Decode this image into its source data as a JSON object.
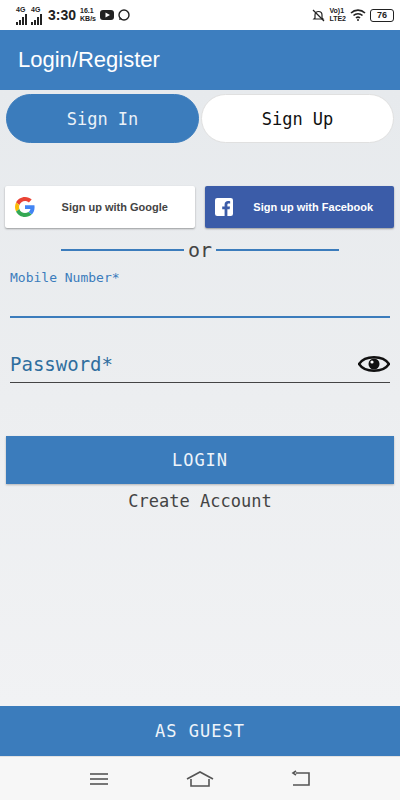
{
  "status_bar": {
    "networks": [
      "4G",
      "4G"
    ],
    "time": "3:30",
    "speed": [
      "16.1",
      "KB/s"
    ],
    "carrier": [
      "Vo)1",
      "LTE2"
    ],
    "battery": "76"
  },
  "app_bar": {
    "title": "Login/Register"
  },
  "tabs": [
    {
      "label": "Sign In",
      "selected": true
    },
    {
      "label": "Sign Up",
      "selected": false
    }
  ],
  "social": [
    {
      "label": "Sign up with Google",
      "kind": "google"
    },
    {
      "label": "Sign up with Facebook",
      "kind": "facebook"
    }
  ],
  "divider": "or",
  "fields": [
    {
      "label": "Mobile Number*",
      "kind": "floating",
      "focused": true
    },
    {
      "label": "Password*",
      "kind": "password",
      "focused": false
    }
  ],
  "login_button": "LOGIN",
  "create_account": "Create Account",
  "guest_button": "AS GUEST"
}
